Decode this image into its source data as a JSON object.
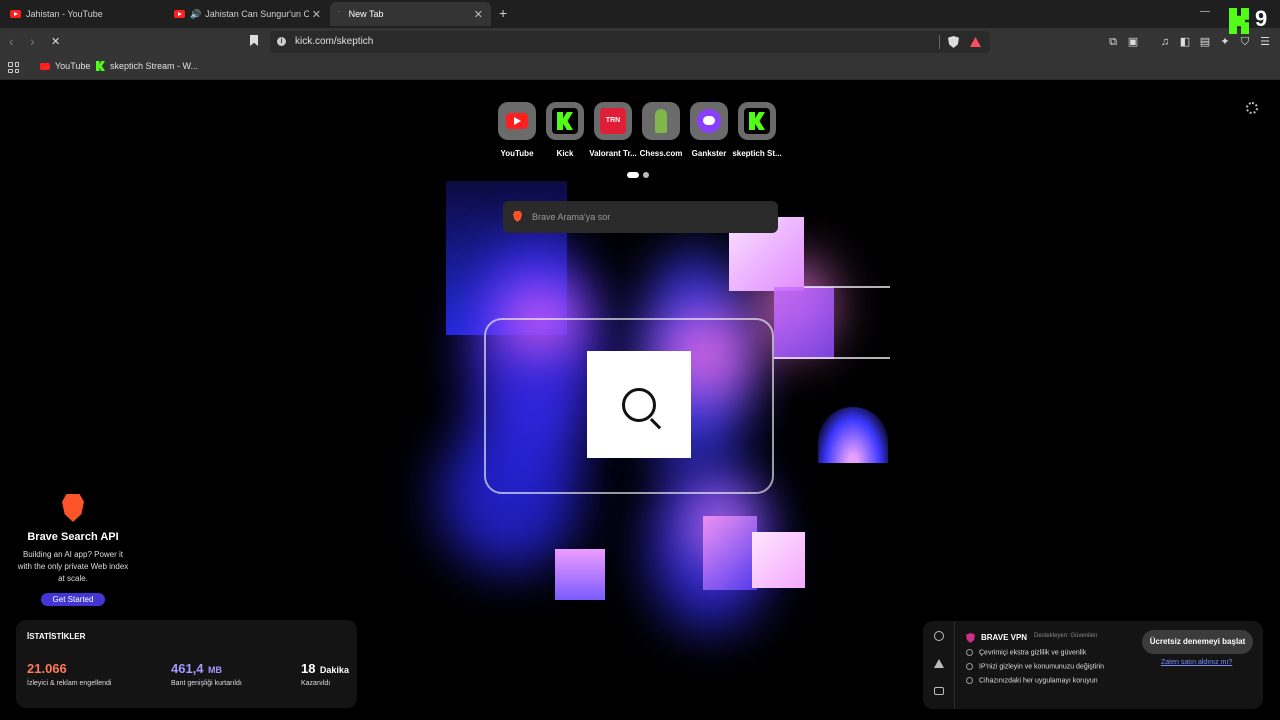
{
  "tabs": [
    {
      "title": "Jahistan - YouTube",
      "active": false
    },
    {
      "title": "Jahistan Can Sungur'un Oyunu",
      "active": false,
      "audio": true
    },
    {
      "title": "New Tab",
      "active": true
    }
  ],
  "toolbar": {
    "url": "kick.com/skeptich"
  },
  "bookmarks": [
    {
      "label": "YouTube",
      "icon": "youtube-icon"
    },
    {
      "label": "skeptich Stream - W...",
      "icon": "kick-icon"
    }
  ],
  "overlay": {
    "kick_number": "9"
  },
  "top_sites": [
    {
      "label": "YouTube",
      "icon": "youtube-icon"
    },
    {
      "label": "Kick",
      "icon": "kick-icon"
    },
    {
      "label": "Valorant Tr...",
      "icon": "trn-icon",
      "icon_text": "TRN"
    },
    {
      "label": "Chess.com",
      "icon": "chess-icon"
    },
    {
      "label": "Gankster",
      "icon": "gankster-icon"
    },
    {
      "label": "skeptich St...",
      "icon": "kick-icon"
    }
  ],
  "search": {
    "placeholder": "Brave Arama'ya sor"
  },
  "api_promo": {
    "title": "Brave Search API",
    "description": "Building an AI app? Power it with the only private Web index at scale.",
    "button": "Get Started"
  },
  "stats": {
    "title": "İSTATİSTİKLER",
    "items": [
      {
        "value": "21.066",
        "unit": "",
        "label": "İzleyici & reklam engellendi",
        "color": "#ff7a59"
      },
      {
        "value": "461,4",
        "unit": "MB",
        "label": "Bant genişliği kurtarıldı",
        "color": "#a497ff"
      },
      {
        "value": "18",
        "unit": "Dakika",
        "label": "Kazanıldı",
        "color": "#ffffff"
      }
    ]
  },
  "vpn": {
    "title": "BRAVE VPN",
    "subtitle": "Destekleyen: Güvenilen",
    "features": [
      "Çevrimiçi ekstra gizlilik ve güvenlik",
      "IP'nizi gizleyin ve konumunuzu değiştirin",
      "Cihazınızdaki her uygulamayı koruyun"
    ],
    "button": "Ücretsiz denemeyi başlat",
    "link": "Zaten satın aldınız mı?"
  },
  "colors": {
    "kick_green": "#53fc18",
    "youtube_red": "#ff1f1f",
    "brave_orange": "#fb542b",
    "accent_purple": "#4436d6"
  }
}
